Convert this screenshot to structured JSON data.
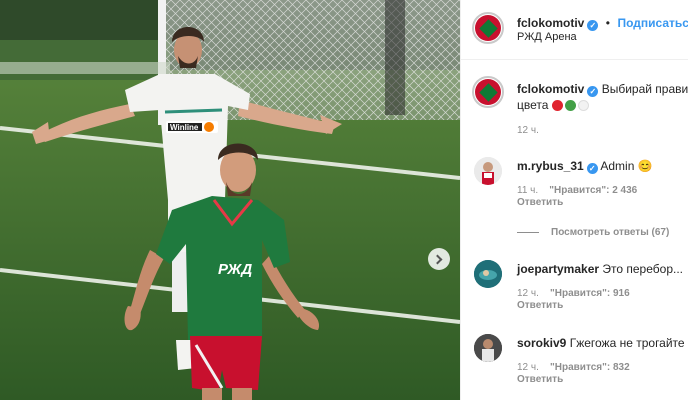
{
  "post": {
    "username": "fclokomotiv",
    "follow_label": "Подписаться",
    "separator": "•",
    "location": "РЖД Арена",
    "caption_text": "Выбирай прави",
    "caption_line2": "цвета",
    "caption_emojis": [
      "red-circle",
      "green-circle",
      "white-circle"
    ],
    "caption_time": "12 ч.",
    "colors": {
      "red": "#e0242e",
      "green": "#43a047",
      "white": "#f2f2f2",
      "link": "#3897f0"
    }
  },
  "photo": {
    "jersey_sponsor": "Winline",
    "front_sponsor": "РЖД",
    "next_arrow_icon": "chevron-right-icon"
  },
  "comments": [
    {
      "username": "m.rybus_31",
      "verified": true,
      "text": "Admin 😊",
      "time": "11 ч.",
      "likes": "\"Нравится\": 2 436",
      "reply_label": "Ответить",
      "view_replies": "Посмотреть ответы (67)"
    },
    {
      "username": "joepartymaker",
      "verified": false,
      "text": "Это перебор...",
      "time": "12 ч.",
      "likes": "\"Нравится\": 916",
      "reply_label": "Ответить"
    },
    {
      "username": "sorokiv9",
      "verified": false,
      "text": "Гжегожа не трогайте",
      "time": "12 ч.",
      "likes": "\"Нравится\": 832",
      "reply_label": "Ответить"
    }
  ]
}
